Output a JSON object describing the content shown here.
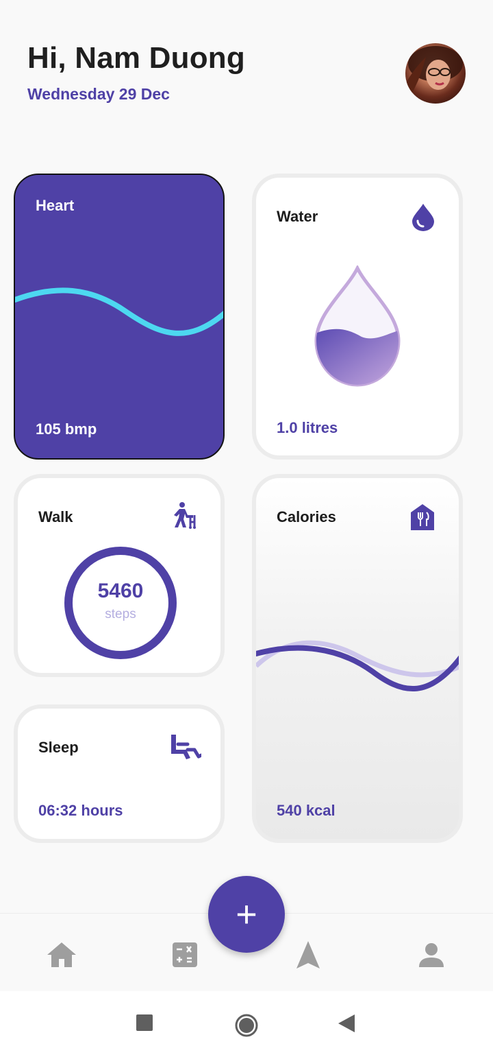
{
  "header": {
    "greeting": "Hi, Nam Duong",
    "date": "Wednesday 29 Dec"
  },
  "cards": {
    "heart": {
      "title": "Heart",
      "value": "105 bmp",
      "icon": "none"
    },
    "water": {
      "title": "Water",
      "value": "1.0 litres",
      "icon": "water-drop-icon"
    },
    "walk": {
      "title": "Walk",
      "steps": "5460",
      "steps_label": "steps",
      "icon": "walker-icon"
    },
    "sleep": {
      "title": "Sleep",
      "value": "06:32 hours",
      "icon": "seat-recline-icon"
    },
    "calories": {
      "title": "Calories",
      "value": "540 kcal",
      "icon": "restaurant-icon"
    }
  },
  "bottom_nav": {
    "items": [
      {
        "name": "home-icon"
      },
      {
        "name": "calculator-icon"
      },
      {
        "name": "navigation-arrow-icon"
      },
      {
        "name": "person-icon"
      }
    ],
    "fab_label": "+"
  },
  "colors": {
    "accent": "#4f41a6",
    "wave": "#4dd8f0",
    "nav_icon": "#9e9e9e"
  }
}
